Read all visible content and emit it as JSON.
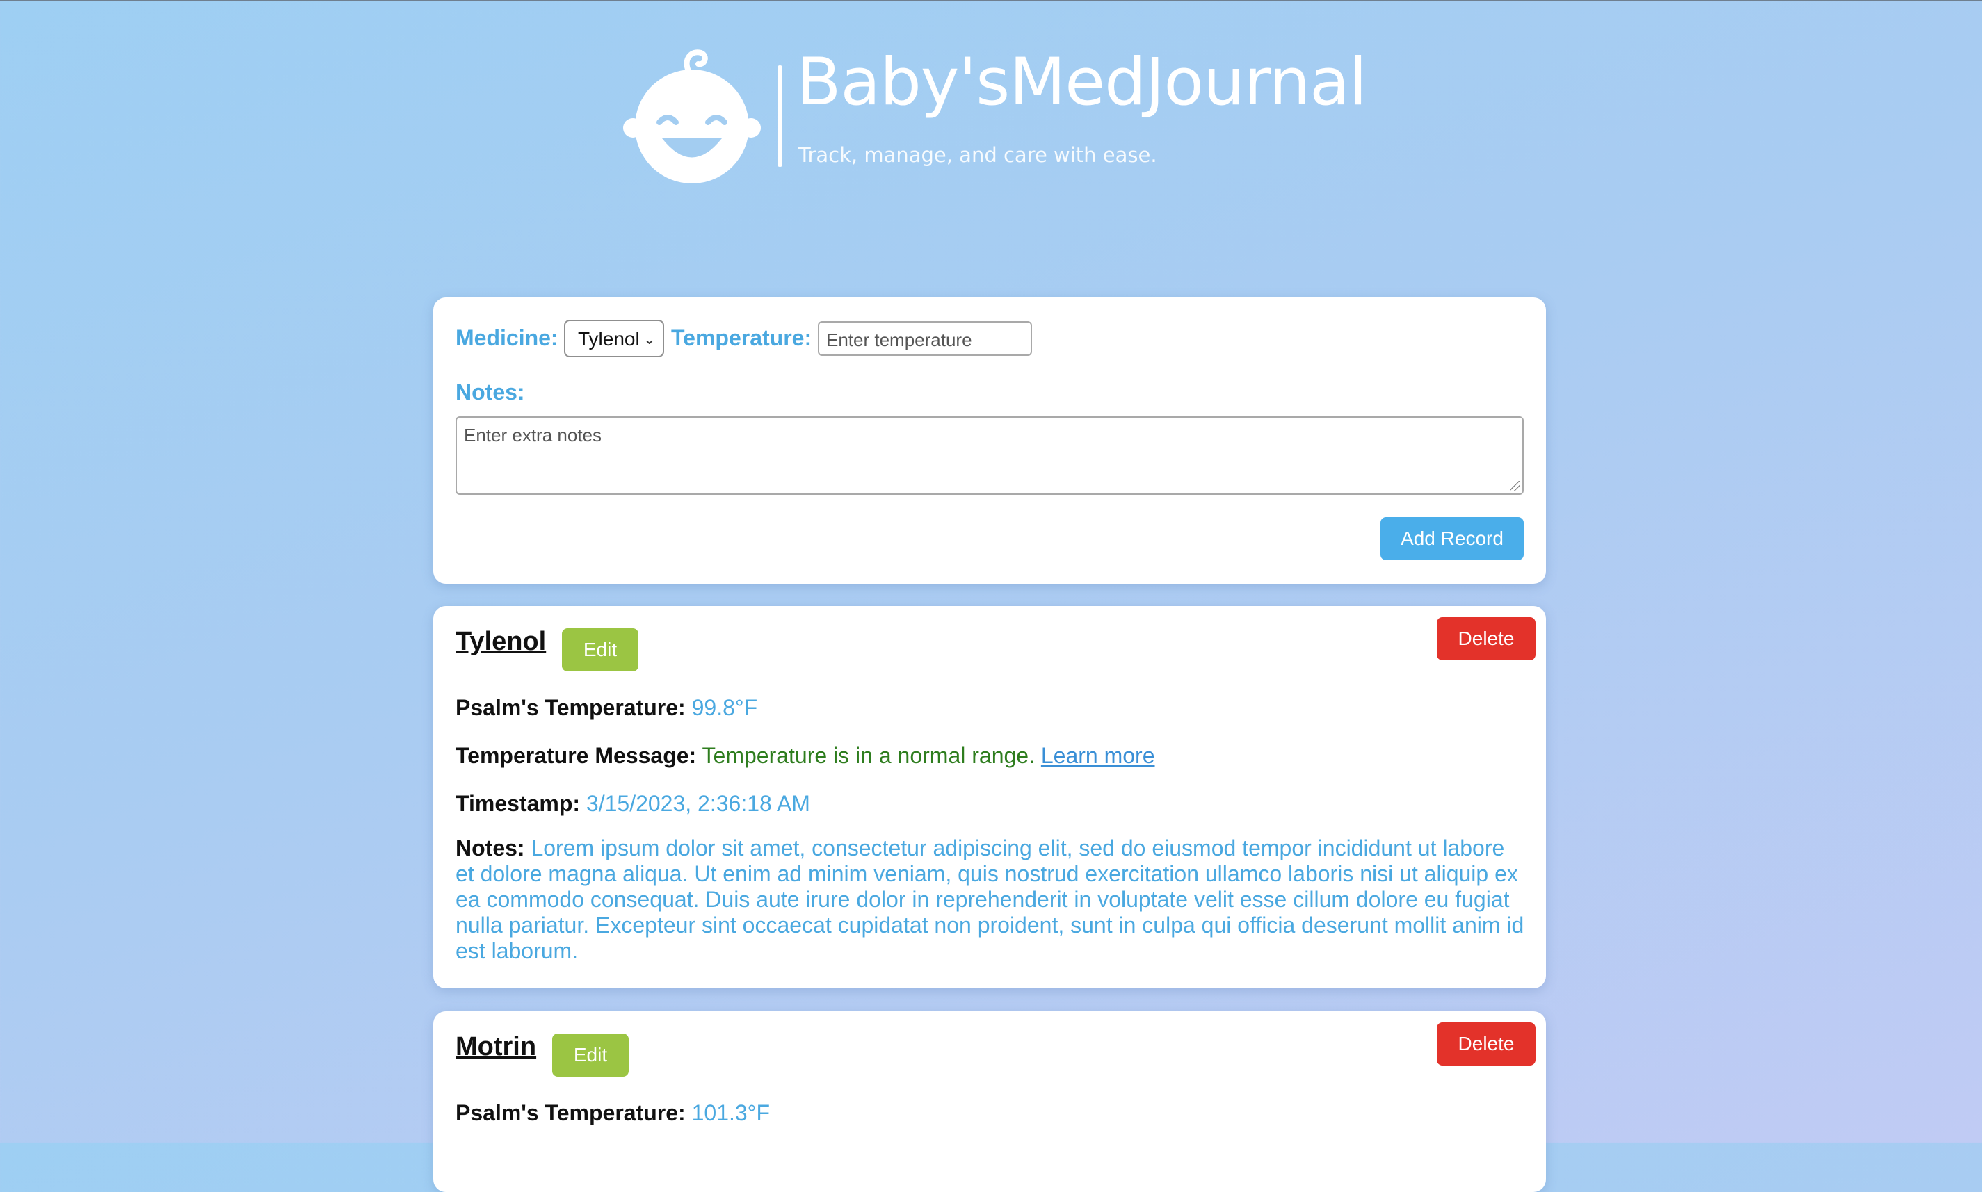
{
  "header": {
    "brand_title": "Baby'sMedJournal",
    "tagline": "Track, manage, and care with ease.",
    "logo_icon": "baby-face-icon"
  },
  "form": {
    "medicine_label": "Medicine:",
    "medicine_selected": "Tylenol",
    "temperature_label": "Temperature:",
    "temperature_placeholder": "Enter temperature",
    "notes_label": "Notes:",
    "notes_placeholder": "Enter extra notes",
    "add_button": "Add Record"
  },
  "records": [
    {
      "medicine": "Tylenol",
      "edit_label": "Edit",
      "delete_label": "Delete",
      "temp_label": "Psalm's Temperature:",
      "temp_value": "99.8°F",
      "message_label": "Temperature Message:",
      "message_value": "Temperature is in a normal range.",
      "learn_more": "Learn more",
      "timestamp_label": "Timestamp:",
      "timestamp_value": "3/15/2023, 2:36:18 AM",
      "notes_label": "Notes:",
      "notes_value": "Lorem ipsum dolor sit amet, consectetur adipiscing elit, sed do eiusmod tempor incididunt ut labore et dolore magna aliqua. Ut enim ad minim veniam, quis nostrud exercitation ullamco laboris nisi ut aliquip ex ea commodo consequat. Duis aute irure dolor in reprehenderit in voluptate velit esse cillum dolore eu fugiat nulla pariatur. Excepteur sint occaecat cupidatat non proident, sunt in culpa qui officia deserunt mollit anim id est laborum."
    },
    {
      "medicine": "Motrin",
      "edit_label": "Edit",
      "delete_label": "Delete",
      "temp_label": "Psalm's Temperature:",
      "temp_value": "101.3°F"
    }
  ],
  "colors": {
    "accent": "#4aa8e0",
    "edit": "#9bc543",
    "delete": "#e3322a",
    "normal_message": "#2e7d1e"
  }
}
